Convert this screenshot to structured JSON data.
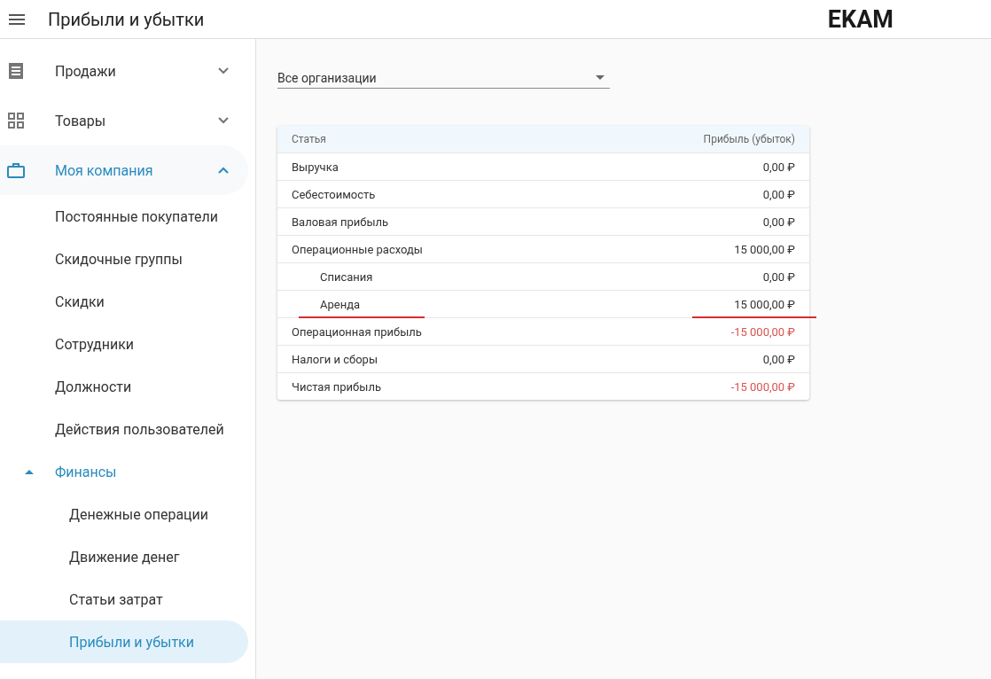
{
  "header": {
    "title": "Прибыли и убытки",
    "logo": "EKAM"
  },
  "sidebar": {
    "items": [
      {
        "label": "Продажи",
        "expanded": false
      },
      {
        "label": "Товары",
        "expanded": false
      },
      {
        "label": "Моя компания",
        "expanded": true,
        "children": [
          {
            "label": "Постоянные покупатели",
            "selected": false
          },
          {
            "label": "Скидочные группы",
            "selected": false
          },
          {
            "label": "Скидки",
            "selected": false
          },
          {
            "label": "Сотрудники",
            "selected": false
          },
          {
            "label": "Должности",
            "selected": false
          },
          {
            "label": "Действия пользователей",
            "selected": false
          },
          {
            "label": "Финансы",
            "selected": false,
            "expanded": true,
            "children": [
              {
                "label": "Денежные операции",
                "selected": false
              },
              {
                "label": "Движение денег",
                "selected": false
              },
              {
                "label": "Статьи затрат",
                "selected": false
              },
              {
                "label": "Прибыли и убытки",
                "selected": true
              }
            ]
          }
        ]
      }
    ]
  },
  "filter": {
    "value": "Все организации"
  },
  "table": {
    "columns": [
      "Статья",
      "Прибыль (убыток)"
    ],
    "rows": [
      {
        "item": "Выручка",
        "amount": "0,00 ₽",
        "negative": false,
        "underlined": false
      },
      {
        "item": "Себестоимость",
        "amount": "0,00 ₽",
        "negative": false,
        "underlined": false
      },
      {
        "item": "Валовая прибыль",
        "amount": "0,00 ₽",
        "negative": false,
        "underlined": false
      },
      {
        "item": "Операционные расходы",
        "amount": "15 000,00 ₽",
        "negative": false,
        "underlined": false,
        "children": [
          {
            "item": "Списания",
            "amount": "0,00 ₽",
            "negative": false,
            "underlined": false
          },
          {
            "item": "Аренда",
            "amount": "15 000,00 ₽",
            "negative": false,
            "underlined": true
          }
        ]
      },
      {
        "item": "Операционная прибыль",
        "amount": "-15 000,00 ₽",
        "negative": true,
        "underlined": false
      },
      {
        "item": "Налоги и сборы",
        "amount": "0,00 ₽",
        "negative": false,
        "underlined": false
      },
      {
        "item": "Чистая прибыль",
        "amount": "-15 000,00 ₽",
        "negative": true,
        "underlined": false
      }
    ]
  }
}
